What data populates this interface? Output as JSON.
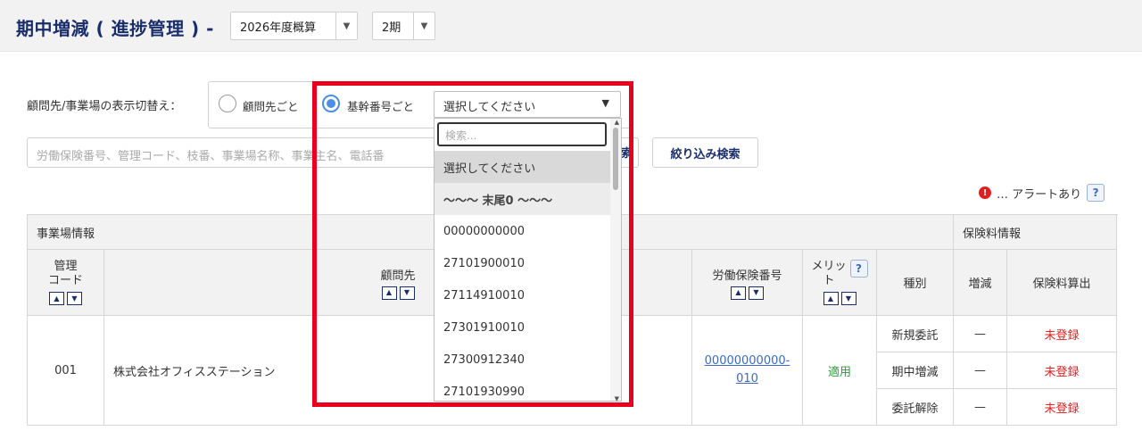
{
  "header": {
    "title": "期中増減 ( 進捗管理 ) -",
    "year_select": "2026年度概算",
    "term_select": "2期"
  },
  "filter": {
    "label": "顧問先/事業場の表示切替え：",
    "radio1": "顧問先ごと",
    "radio2": "基幹番号ごと",
    "select_value": "選択してください",
    "search_placeholder": "労働保険番号、管理コード、枝番、事業場名称、事業主名、電話番",
    "search_btn_fragment": "索",
    "narrow_button": "絞り込み検索"
  },
  "alert": {
    "icon": "!",
    "text": "… アラートあり",
    "help": "?"
  },
  "dropdown": {
    "search_placeholder": "検索...",
    "options": [
      "選択してください",
      "～～～ 末尾0 ～～～",
      "00000000000",
      "27101900010",
      "27114910010",
      "27301910010",
      "27300912340",
      "27101930990"
    ]
  },
  "table": {
    "group1": "事業場情報",
    "group2": "保険料情報",
    "col_code": "管理\nコード",
    "col_client": "顧問先",
    "col_insurance_no": "労働保険番号",
    "col_merit": "メリッ\nト",
    "col_type": "種別",
    "col_change": "増減",
    "col_calc": "保険料算出",
    "row": {
      "code": "001",
      "name": "株式会社オフィスステーション",
      "insurance_no": "00000000000-\n010",
      "merit": "適用",
      "types": [
        "新規委託",
        "期中増減",
        "委託解除"
      ],
      "changes": [
        "—",
        "—",
        "—"
      ],
      "calcs": [
        "未登録",
        "未登録",
        "未登録"
      ]
    }
  },
  "colors": {
    "accent": "#1a2e6c",
    "link": "#3b6cc0",
    "alert": "#e02020",
    "frame": "#e8001c",
    "applied": "#2a9a3a"
  }
}
